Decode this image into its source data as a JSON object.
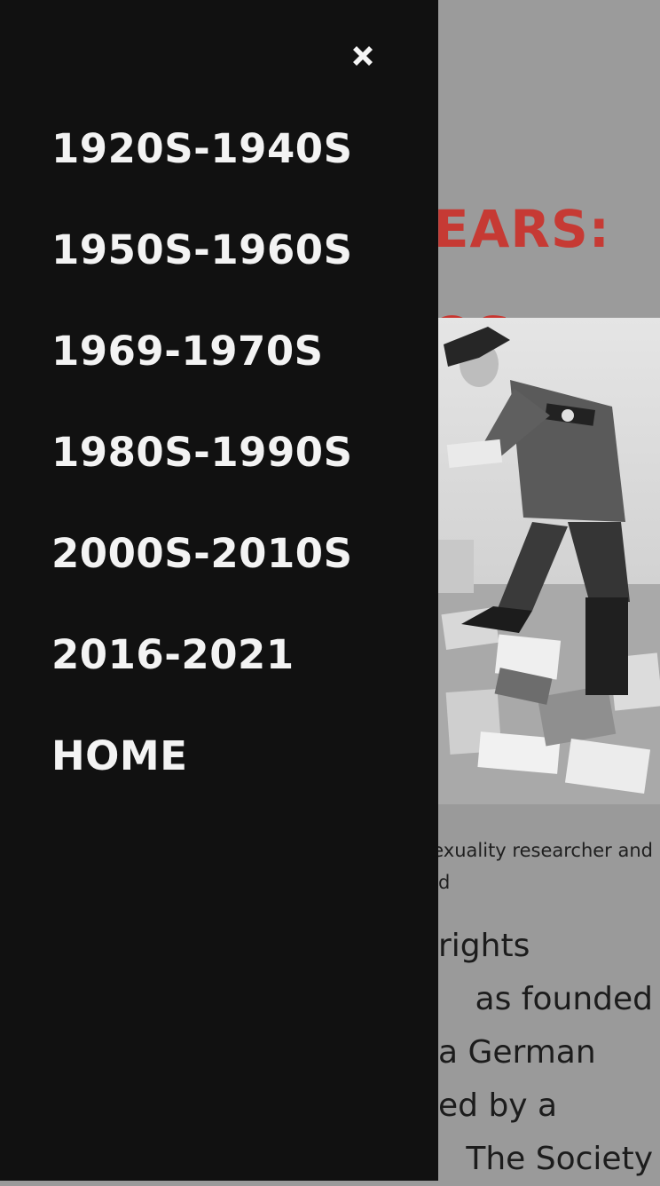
{
  "menu": {
    "close_icon": "close-x-icon",
    "items": [
      {
        "label": "1920S-1940S"
      },
      {
        "label": "1950S-1960S"
      },
      {
        "label": "1969-1970S"
      },
      {
        "label": "1980S-1990S"
      },
      {
        "label": "2000S-2010S"
      },
      {
        "label": "2016-2021"
      },
      {
        "label": "HOME"
      }
    ]
  },
  "hero": {
    "title_line1": "EARS:",
    "title_line2": "OS"
  },
  "caption": {
    "line1": "exuality researcher and",
    "line2": "d"
  },
  "body": {
    "line1": "rights",
    "line2": "as founded",
    "line3": "a German",
    "line4": "ed by a",
    "line5": "The Society"
  },
  "colors": {
    "drawer_bg": "#111111",
    "menu_text": "#f3f3f3",
    "title_red": "#c63a34",
    "title_olive": "#6e7a32",
    "overlay_gray": "#9a9a9a"
  }
}
